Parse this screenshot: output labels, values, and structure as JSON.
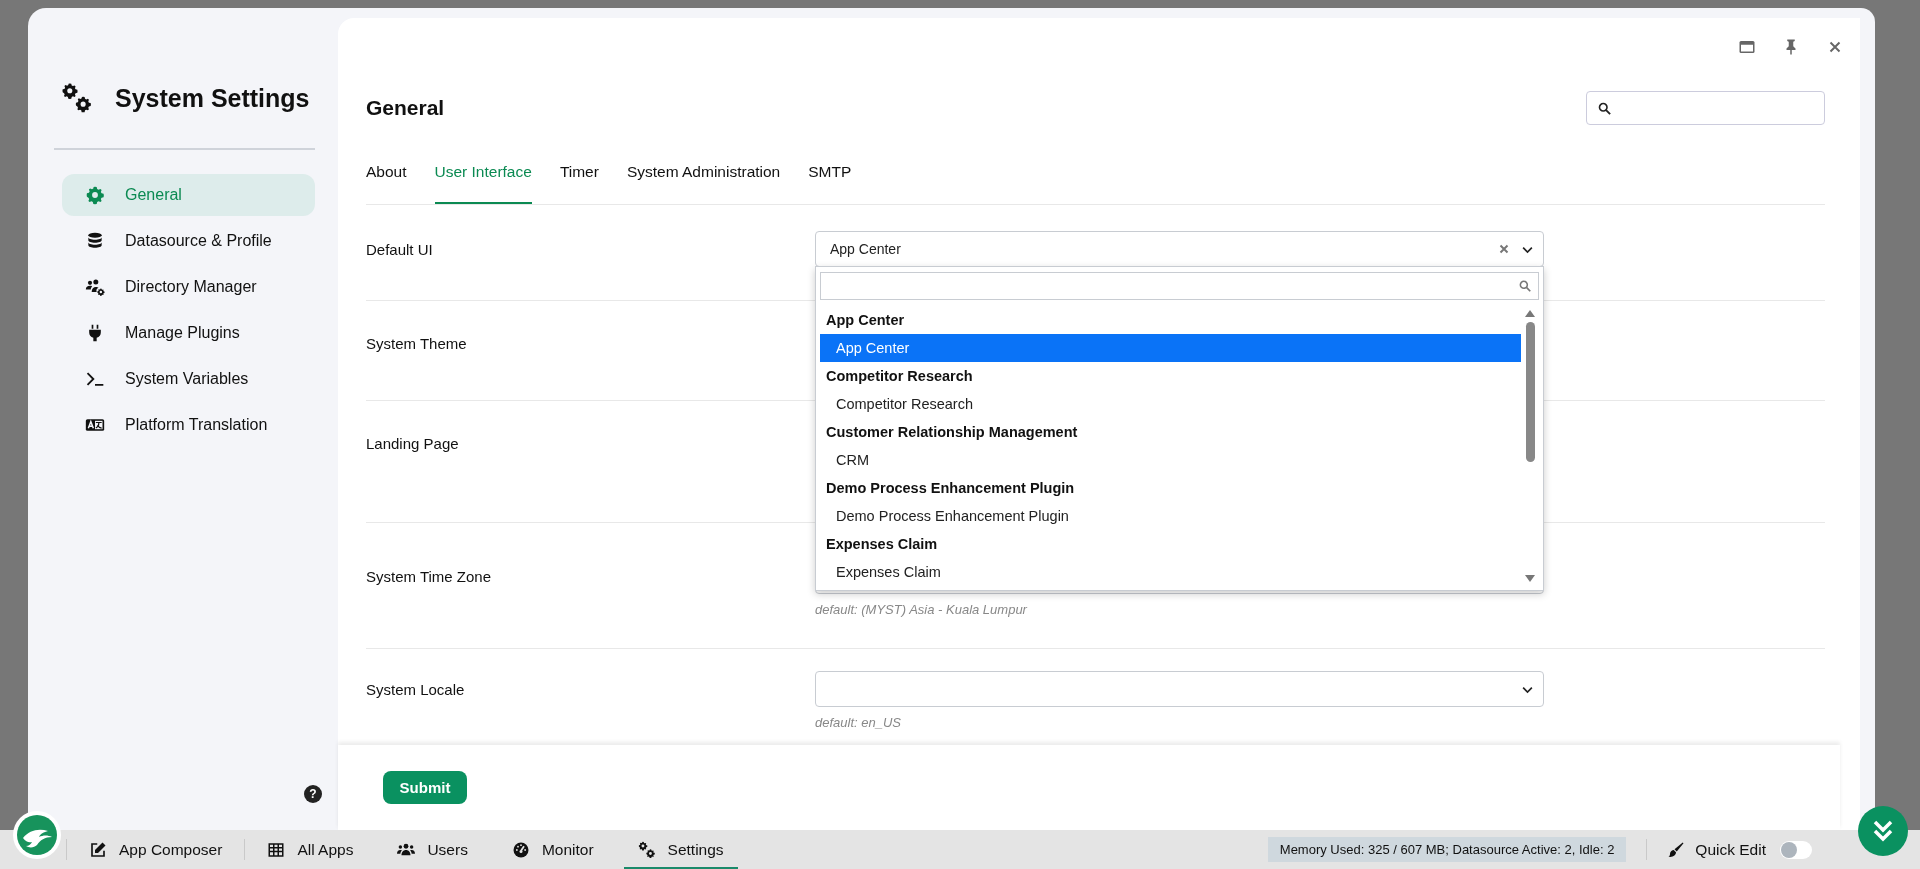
{
  "sidebar": {
    "title": "System Settings",
    "items": [
      {
        "label": "General",
        "selected": true
      },
      {
        "label": "Datasource & Profile",
        "selected": false
      },
      {
        "label": "Directory Manager",
        "selected": false
      },
      {
        "label": "Manage Plugins",
        "selected": false
      },
      {
        "label": "System Variables",
        "selected": false
      },
      {
        "label": "Platform Translation",
        "selected": false
      }
    ],
    "help": "?"
  },
  "panel": {
    "title": "General",
    "tabs": [
      {
        "label": "About",
        "selected": false
      },
      {
        "label": "User Interface",
        "selected": true
      },
      {
        "label": "Timer",
        "selected": false
      },
      {
        "label": "System Administration",
        "selected": false
      },
      {
        "label": "SMTP",
        "selected": false
      }
    ],
    "fields": [
      {
        "label": "Default UI",
        "value": "App Center"
      },
      {
        "label": "System Theme"
      },
      {
        "label": "Landing Page"
      },
      {
        "label": "System Time Zone",
        "hint": "default: (MYST) Asia - Kuala Lumpur"
      },
      {
        "label": "System Locale",
        "hint": "default: en_US"
      }
    ],
    "dropdown": {
      "groups": [
        {
          "label": "App Center",
          "options": [
            {
              "label": "App Center",
              "selected": true
            }
          ]
        },
        {
          "label": "Competitor Research",
          "options": [
            {
              "label": "Competitor Research",
              "selected": false
            }
          ]
        },
        {
          "label": "Customer Relationship Management",
          "options": [
            {
              "label": "CRM",
              "selected": false
            }
          ]
        },
        {
          "label": "Demo Process Enhancement Plugin",
          "options": [
            {
              "label": "Demo Process Enhancement Plugin",
              "selected": false
            }
          ]
        },
        {
          "label": "Expenses Claim",
          "options": [
            {
              "label": "Expenses Claim",
              "selected": false
            }
          ]
        }
      ]
    },
    "submit": "Submit"
  },
  "taskbar": {
    "items": [
      {
        "label": "App Composer",
        "selected": false
      },
      {
        "label": "All Apps",
        "selected": false
      },
      {
        "label": "Users",
        "selected": false
      },
      {
        "label": "Monitor",
        "selected": false
      },
      {
        "label": "Settings",
        "selected": true
      }
    ],
    "status": "Memory Used: 325 / 607 MB; Datasource Active: 2, Idle: 2",
    "quick_edit": {
      "label": "Quick Edit",
      "on": false
    }
  }
}
